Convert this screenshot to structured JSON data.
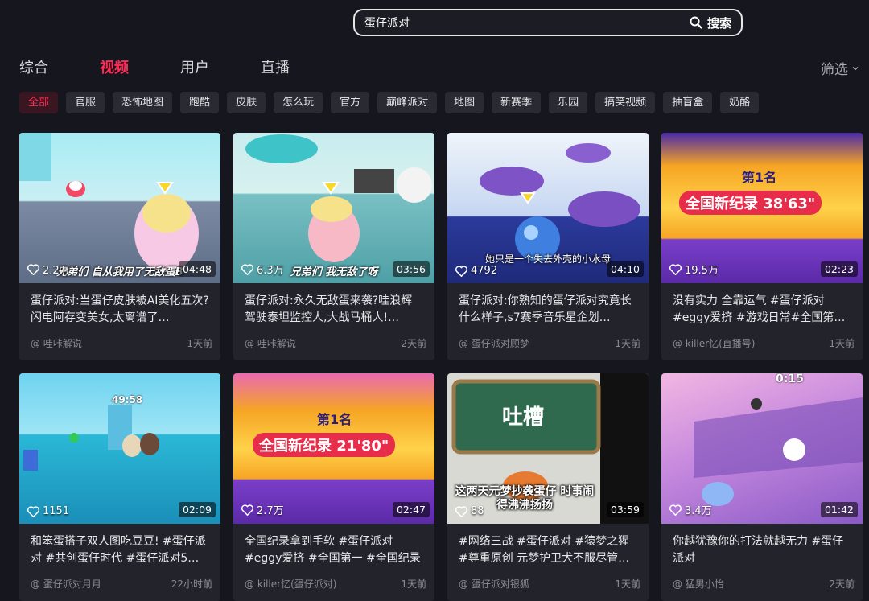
{
  "search": {
    "value": "蛋仔派对",
    "button_label": "搜索"
  },
  "tabs": [
    {
      "label": "综合",
      "active": false
    },
    {
      "label": "视频",
      "active": true
    },
    {
      "label": "用户",
      "active": false
    },
    {
      "label": "直播",
      "active": false
    }
  ],
  "filter_label": "筛选",
  "chips": [
    "全部",
    "官服",
    "恐怖地图",
    "跑酷",
    "皮肤",
    "怎么玩",
    "官方",
    "巅峰派对",
    "地图",
    "新赛季",
    "乐园",
    "搞笑视频",
    "抽盲盒",
    "奶酪"
  ],
  "videos": [
    {
      "likes": "2.2万",
      "duration": "04:48",
      "title": "蛋仔派对:当蛋仔皮肤被AI美化五次?闪电阿存变美女,太离谱了…",
      "author": "@ 哇咔解说",
      "time": "1天前",
      "caption": "兄弟们 自从我用了无敌蛋B"
    },
    {
      "likes": "6.3万",
      "duration": "03:56",
      "title": "蛋仔派对:永久无敌蛋来袭?哇浪辉驾驶泰坦监控人,大战马桶人!…",
      "author": "@ 哇咔解说",
      "time": "2天前",
      "caption": "兄弟们 我无敌了呀"
    },
    {
      "likes": "4792",
      "duration": "04:10",
      "title": "蛋仔派对:你熟知的蛋仔派对究竟长什么样子,s7赛季音乐星企划…",
      "author": "@ 蛋仔派对顾梦",
      "time": "1天前",
      "caption": "她只是一个失去外壳的小水母"
    },
    {
      "likes": "19.5万",
      "duration": "02:23",
      "title": "没有实力 全靠运气 #蛋仔派对#eggy爱挤 #游戏日常#全国第一 #全…",
      "author": "@ killer忆(直播号)",
      "time": "1天前",
      "rank": "第1名",
      "record": "全国新纪录 38'63\""
    },
    {
      "likes": "1151",
      "duration": "02:09",
      "title": "和笨蛋搭子双人图吃豆豆! #蛋仔派对 #共创蛋仔时代 #蛋仔派对5…",
      "author": "@ 蛋仔派对月月",
      "time": "22小时前",
      "timer": "49:58"
    },
    {
      "likes": "2.7万",
      "duration": "02:47",
      "title": "全国纪录拿到手软 #蛋仔派对 #eggy爱挤 #全国第一 #全国纪录",
      "author": "@ killer忆(蛋仔派对)",
      "time": "1天前",
      "rank": "第1名",
      "record": "全国新纪录 21'80\""
    },
    {
      "likes": "88",
      "duration": "03:59",
      "title": "#网络三战 #蛋仔派对 #猿梦之猩 #尊重原创 元梦护卫犬不服尽管来…",
      "author": "@ 蛋仔派对银狐",
      "time": "1天前",
      "board": "吐槽",
      "caption": "这两天元梦抄袭蛋仔 时事闹得沸沸扬扬"
    },
    {
      "likes": "3.4万",
      "duration": "01:42",
      "title": "你越犹豫你的打法就越无力 #蛋仔派对",
      "author": "@ 猛男小怡",
      "time": "2天前",
      "timer": "0:15"
    }
  ]
}
